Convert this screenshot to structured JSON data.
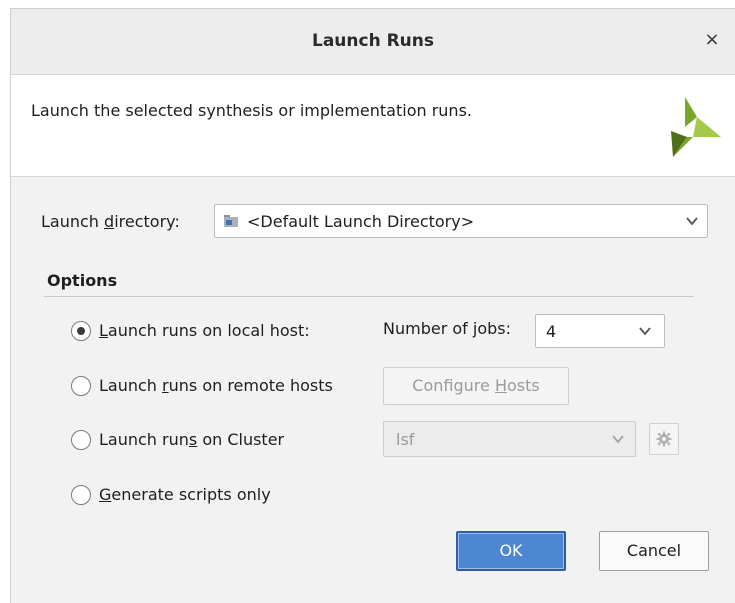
{
  "dialog": {
    "title": "Launch Runs",
    "close_glyph": "×",
    "description": "Launch the selected synthesis or implementation runs."
  },
  "launch_directory": {
    "label_pre": "Launch ",
    "label_mnemonic": "d",
    "label_post": "irectory:",
    "value": "<Default Launch Directory>"
  },
  "options": {
    "title": "Options",
    "local": {
      "label_pre": "",
      "label_mnemonic": "L",
      "label_post": "aunch runs on local host:",
      "selected": true
    },
    "jobs": {
      "label_pre": "Number of ",
      "label_mnemonic": "j",
      "label_post": "obs:",
      "value": "4"
    },
    "remote": {
      "label_pre": "Launch ",
      "label_mnemonic": "r",
      "label_post": "uns on remote hosts",
      "selected": false
    },
    "configure_hosts": {
      "label_pre": "Configure ",
      "label_mnemonic": "H",
      "label_post": "osts"
    },
    "cluster": {
      "label_pre": "Launch run",
      "label_mnemonic": "s",
      "label_post": " on Cluster",
      "selected": false,
      "value": "lsf"
    },
    "scripts": {
      "label_pre": "",
      "label_mnemonic": "G",
      "label_post": "enerate scripts only",
      "selected": false
    }
  },
  "buttons": {
    "ok": "OK",
    "cancel": "Cancel"
  },
  "colors": {
    "ok_button": "#4d86d1",
    "logo_green": "#79a52a",
    "logo_dark": "#4f6e19"
  }
}
